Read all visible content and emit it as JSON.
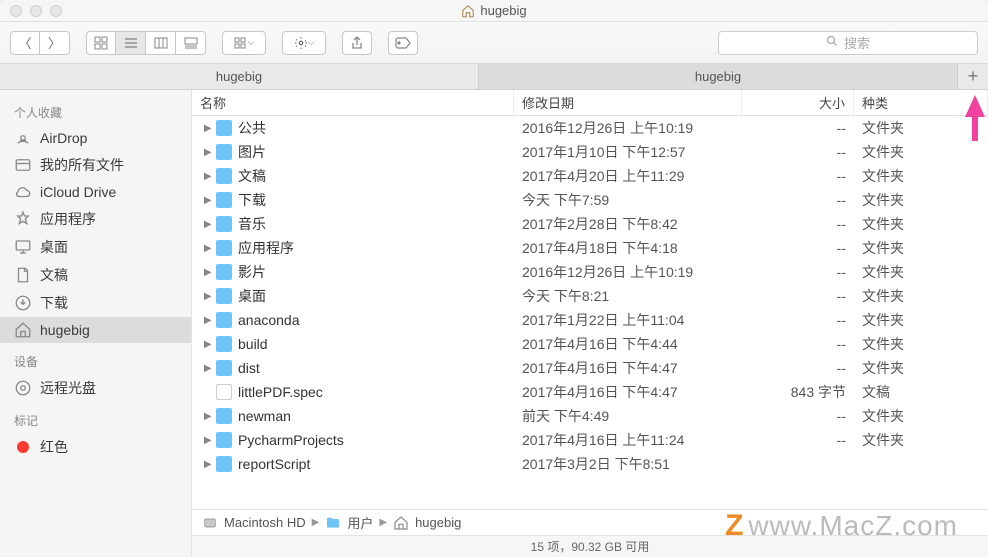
{
  "window": {
    "title": "hugebig"
  },
  "toolbar": {
    "search_placeholder": "搜索"
  },
  "tabs": [
    {
      "label": "hugebig",
      "active": false
    },
    {
      "label": "hugebig",
      "active": true
    }
  ],
  "sidebar": {
    "sections": [
      {
        "header": "个人收藏",
        "items": [
          {
            "icon": "airdrop",
            "label": "AirDrop"
          },
          {
            "icon": "allfiles",
            "label": "我的所有文件"
          },
          {
            "icon": "icloud",
            "label": "iCloud Drive"
          },
          {
            "icon": "apps",
            "label": "应用程序"
          },
          {
            "icon": "desktop",
            "label": "桌面"
          },
          {
            "icon": "docs",
            "label": "文稿"
          },
          {
            "icon": "downloads",
            "label": "下载"
          },
          {
            "icon": "home",
            "label": "hugebig",
            "selected": true
          }
        ]
      },
      {
        "header": "设备",
        "items": [
          {
            "icon": "disc",
            "label": "远程光盘"
          }
        ]
      },
      {
        "header": "标记",
        "items": [
          {
            "icon": "tag",
            "color": "#fc3b30",
            "label": "红色"
          }
        ]
      }
    ]
  },
  "columns": {
    "name": "名称",
    "date": "修改日期",
    "size": "大小",
    "kind": "种类"
  },
  "files": [
    {
      "name": "公共",
      "date": "2016年12月26日 上午10:19",
      "size": "--",
      "kind": "文件夹",
      "folder": true
    },
    {
      "name": "图片",
      "date": "2017年1月10日 下午12:57",
      "size": "--",
      "kind": "文件夹",
      "folder": true
    },
    {
      "name": "文稿",
      "date": "2017年4月20日 上午11:29",
      "size": "--",
      "kind": "文件夹",
      "folder": true
    },
    {
      "name": "下载",
      "date": "今天 下午7:59",
      "size": "--",
      "kind": "文件夹",
      "folder": true
    },
    {
      "name": "音乐",
      "date": "2017年2月28日 下午8:42",
      "size": "--",
      "kind": "文件夹",
      "folder": true
    },
    {
      "name": "应用程序",
      "date": "2017年4月18日 下午4:18",
      "size": "--",
      "kind": "文件夹",
      "folder": true
    },
    {
      "name": "影片",
      "date": "2016年12月26日 上午10:19",
      "size": "--",
      "kind": "文件夹",
      "folder": true
    },
    {
      "name": "桌面",
      "date": "今天 下午8:21",
      "size": "--",
      "kind": "文件夹",
      "folder": true
    },
    {
      "name": "anaconda",
      "date": "2017年1月22日 上午11:04",
      "size": "--",
      "kind": "文件夹",
      "folder": true
    },
    {
      "name": "build",
      "date": "2017年4月16日 下午4:44",
      "size": "--",
      "kind": "文件夹",
      "folder": true
    },
    {
      "name": "dist",
      "date": "2017年4月16日 下午4:47",
      "size": "--",
      "kind": "文件夹",
      "folder": true
    },
    {
      "name": "littlePDF.spec",
      "date": "2017年4月16日 下午4:47",
      "size": "843 字节",
      "kind": "文稿",
      "folder": false
    },
    {
      "name": "newman",
      "date": "前天 下午4:49",
      "size": "--",
      "kind": "文件夹",
      "folder": true
    },
    {
      "name": "PycharmProjects",
      "date": "2017年4月16日 上午11:24",
      "size": "--",
      "kind": "文件夹",
      "folder": true
    },
    {
      "name": "reportScript",
      "date": "2017年3月2日 下午8:51",
      "size": "",
      "kind": "",
      "folder": true
    }
  ],
  "path": [
    {
      "icon": "hdd",
      "label": "Macintosh HD"
    },
    {
      "icon": "folder",
      "label": "用户"
    },
    {
      "icon": "home",
      "label": "hugebig"
    }
  ],
  "status": "15 项，90.32 GB 可用",
  "watermark": "www.MacZ.com"
}
